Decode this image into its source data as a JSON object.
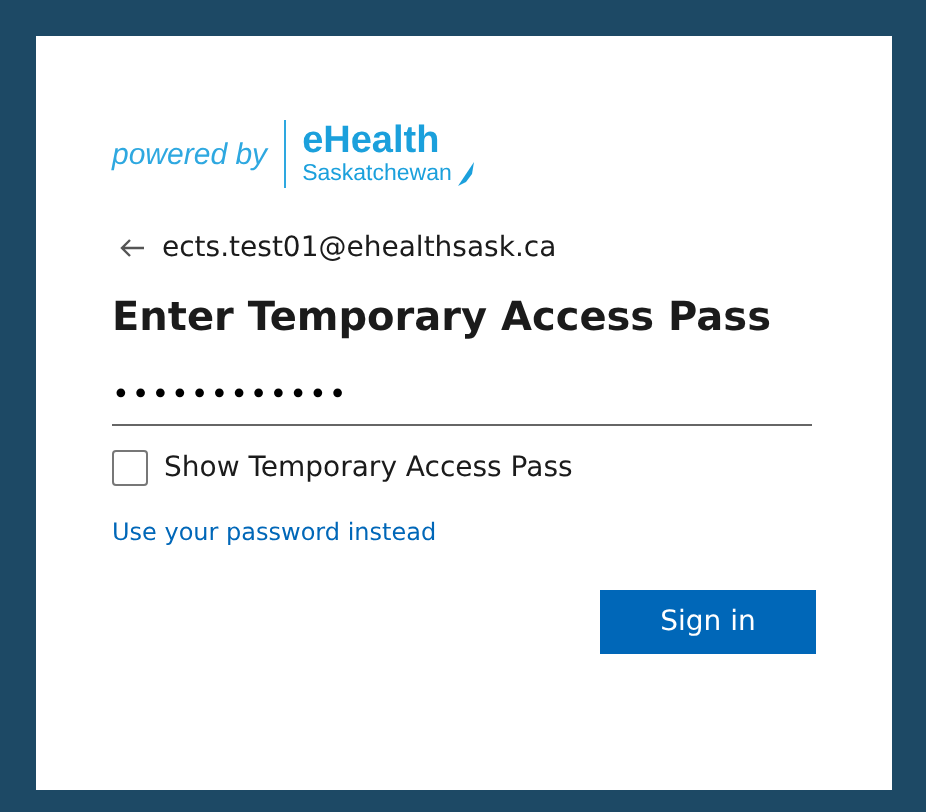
{
  "logo": {
    "prefix": "powered by",
    "brand": "eHealth",
    "region": "Saskatchewan"
  },
  "account": "ects.test01@ehealthsask.ca",
  "title": "Enter Temporary Access Pass",
  "pass_field": {
    "value": "••••••••••••"
  },
  "show_pass": {
    "label": "Show Temporary Access Pass",
    "checked": false
  },
  "link": "Use your password instead",
  "button": "Sign in"
}
